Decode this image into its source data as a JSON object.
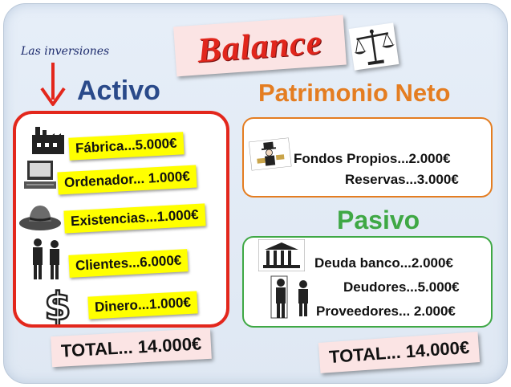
{
  "title": "Balance",
  "annotation": "Las inversiones",
  "activo": {
    "heading": "Activo",
    "items": [
      {
        "label": "Fábrica...5.000€",
        "icon": "factory-icon"
      },
      {
        "label": "Ordenador...  1.000€",
        "icon": "computer-icon"
      },
      {
        "label": "Existencias...1.000€",
        "icon": "hat-icon"
      },
      {
        "label": "Clientes...6.000€",
        "icon": "people-icon"
      },
      {
        "label": "Dinero...1.000€",
        "icon": "dollar-icon"
      }
    ],
    "total": "TOTAL... 14.000€"
  },
  "patrimonio": {
    "heading": "Patrimonio Neto",
    "items": [
      "Fondos Propios...2.000€",
      "Reservas...3.000€"
    ]
  },
  "pasivo": {
    "heading": "Pasivo",
    "items": [
      "Deuda banco...2.000€",
      "Deudores...5.000€",
      "Proveedores...  2.000€"
    ],
    "total": "TOTAL... 14.000€"
  },
  "colors": {
    "title_red": "#e1261c",
    "activo_blue": "#2a4a8a",
    "patrimonio_orange": "#e47d21",
    "pasivo_green": "#3fa845",
    "highlight_yellow": "#ffff00"
  }
}
